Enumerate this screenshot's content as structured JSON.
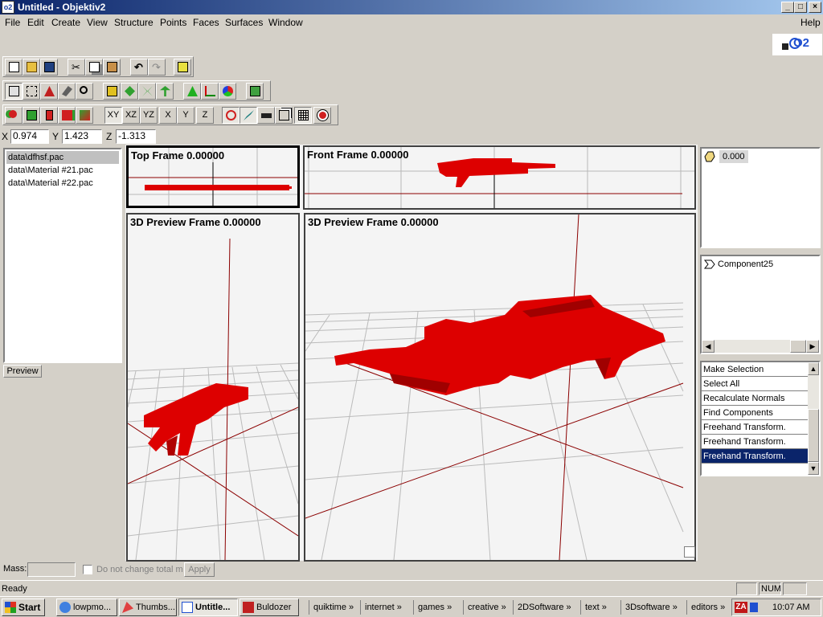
{
  "window": {
    "title": "Untitled - Objektiv2",
    "app_icon": "o2-app-icon",
    "minimize": "_",
    "maximize": "□",
    "close": "×"
  },
  "menu": {
    "items": [
      "File",
      "Edit",
      "Create",
      "View",
      "Structure",
      "Points",
      "Faces",
      "Surfaces",
      "Window"
    ],
    "help": "Help"
  },
  "logo": {
    "text": "O2"
  },
  "toolbar1": {
    "icons": [
      "new-file-icon",
      "open-folder-icon",
      "save-icon",
      "cut-icon",
      "copy-icon",
      "paste-icon",
      "undo-icon",
      "redo-icon",
      "view-icon"
    ]
  },
  "toolbar2": {
    "icons": [
      "select-icon",
      "select-lasso-icon",
      "select-face-icon",
      "select-erase-icon",
      "zoom-icon",
      "move-icon",
      "rotate-icon",
      "mirror-icon",
      "scale-icon",
      "triangle-icon",
      "axis-icon",
      "color-icon",
      "grid-icon"
    ]
  },
  "toolbar3": {
    "buttons": [
      "XY",
      "XZ",
      "YZ",
      "X",
      "Y",
      "Z"
    ]
  },
  "coords": {
    "x_label": "X",
    "x_value": "0.974",
    "y_label": "Y",
    "y_value": "1.423",
    "z_label": "Z",
    "z_value": "-1.313"
  },
  "files": {
    "items": [
      "data\\dfhsf.pac",
      "data\\Material #21.pac",
      "data\\Material #22.pac"
    ],
    "selected_index": 0,
    "preview_button": "Preview"
  },
  "viewports": {
    "top": "Top Frame 0.00000",
    "front": "Front Frame 0.00000",
    "preview_left": "3D Preview Frame 0.00000",
    "preview_main": "3D Preview Frame 0.00000"
  },
  "right_panel": {
    "lod_value": "0.000",
    "component": "Component25",
    "history": [
      "Make Selection",
      "Select All",
      "Recalculate Normals",
      "Find Components",
      "Freehand Transform.",
      "Freehand Transform.",
      "Freehand Transform."
    ],
    "history_selected_index": 6
  },
  "mass": {
    "label": "Mass:",
    "value": "",
    "checkbox_label": "Do not change total mass",
    "apply_button": "Apply"
  },
  "status": {
    "text": "Ready",
    "num": "NUM"
  },
  "taskbar": {
    "start": "Start",
    "tasks": [
      {
        "label": "lowpmo..."
      },
      {
        "label": "Thumbs..."
      },
      {
        "label": "Untitle..."
      },
      {
        "label": "Buldozer"
      }
    ],
    "quicklaunch": [
      "quiktime",
      "internet",
      "games",
      "creative",
      "2DSoftware",
      "text",
      "3Dsoftware",
      "editors"
    ],
    "clock": "10:07 AM"
  },
  "colors": {
    "model": "#dd0000",
    "axis": "#8b0000",
    "title_dark": "#0a246a",
    "selection": "#0a246a"
  }
}
